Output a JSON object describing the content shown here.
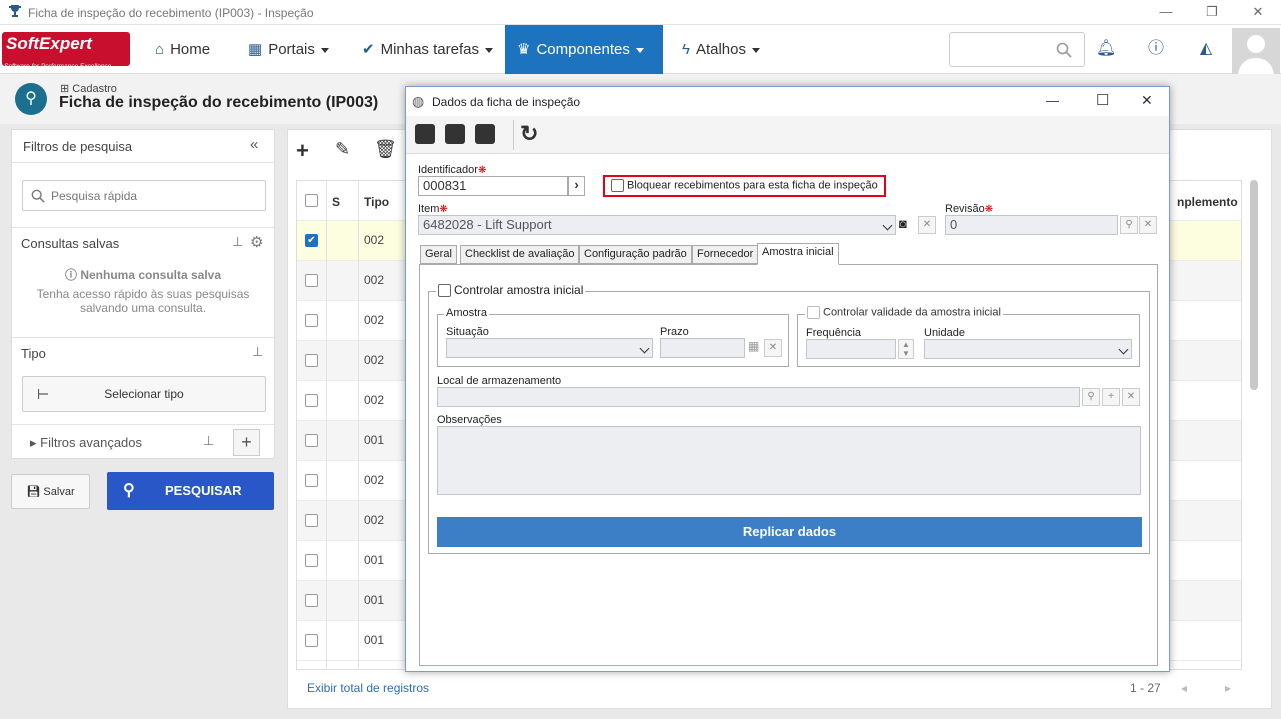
{
  "window": {
    "title": "Ficha de inspeção do recebimento (IP003) - Inspeção"
  },
  "nav": {
    "logo_main": "SoftExpert",
    "logo_sub": "Software for Performance Excellence",
    "items": [
      {
        "label": "Home",
        "icon": "home-icon"
      },
      {
        "label": "Portais",
        "icon": "grid-icon"
      },
      {
        "label": "Minhas tarefas",
        "icon": "check-icon"
      },
      {
        "label": "Componentes",
        "icon": "trophy-icon"
      },
      {
        "label": "Atalhos",
        "icon": "bolt-icon"
      }
    ]
  },
  "page": {
    "breadcrumb": "Cadastro",
    "title": "Ficha de inspeção do recebimento (IP003)"
  },
  "filters": {
    "title": "Filtros de pesquisa",
    "quick_placeholder": "Pesquisa rápida",
    "saved_title": "Consultas salvas",
    "saved_empty": "Nenhuma consulta salva",
    "saved_hint": "Tenha acesso rápido às suas pesquisas salvando uma consulta.",
    "tipo_title": "Tipo",
    "select_tipo": "Selecionar tipo",
    "advanced": "Filtros avançados",
    "save_label": "Salvar",
    "search_label": "PESQUISAR"
  },
  "grid": {
    "col_s": "S",
    "col_tipo": "Tipo",
    "col_complement": "nplemento",
    "rows": [
      "002",
      "002",
      "002",
      "002",
      "002",
      "001",
      "002",
      "002",
      "001",
      "001",
      "001"
    ],
    "footer_link": "Exibir total de registros",
    "count": "1 - 27"
  },
  "dialog": {
    "title": "Dados da ficha de inspeção",
    "identificador_label": "Identificador",
    "identificador_value": "000831",
    "bloquear_label": "Bloquear recebimentos para esta ficha de inspeção",
    "item_label": "Item",
    "item_value": "6482028 - Lift Support",
    "revisao_label": "Revisão",
    "revisao_value": "0",
    "tabs": [
      "Geral",
      "Checklist de avaliação",
      "Configuração padrão",
      "Fornecedor",
      "Amostra inicial"
    ],
    "controlar_amostra": "Controlar amostra inicial",
    "amostra_group": "Amostra",
    "situacao_label": "Situação",
    "prazo_label": "Prazo",
    "validade_label": "Controlar validade da amostra inicial",
    "frequencia_label": "Frequência",
    "unidade_label": "Unidade",
    "local_label": "Local de armazenamento",
    "observacoes_label": "Observações",
    "replicar_label": "Replicar dados"
  }
}
